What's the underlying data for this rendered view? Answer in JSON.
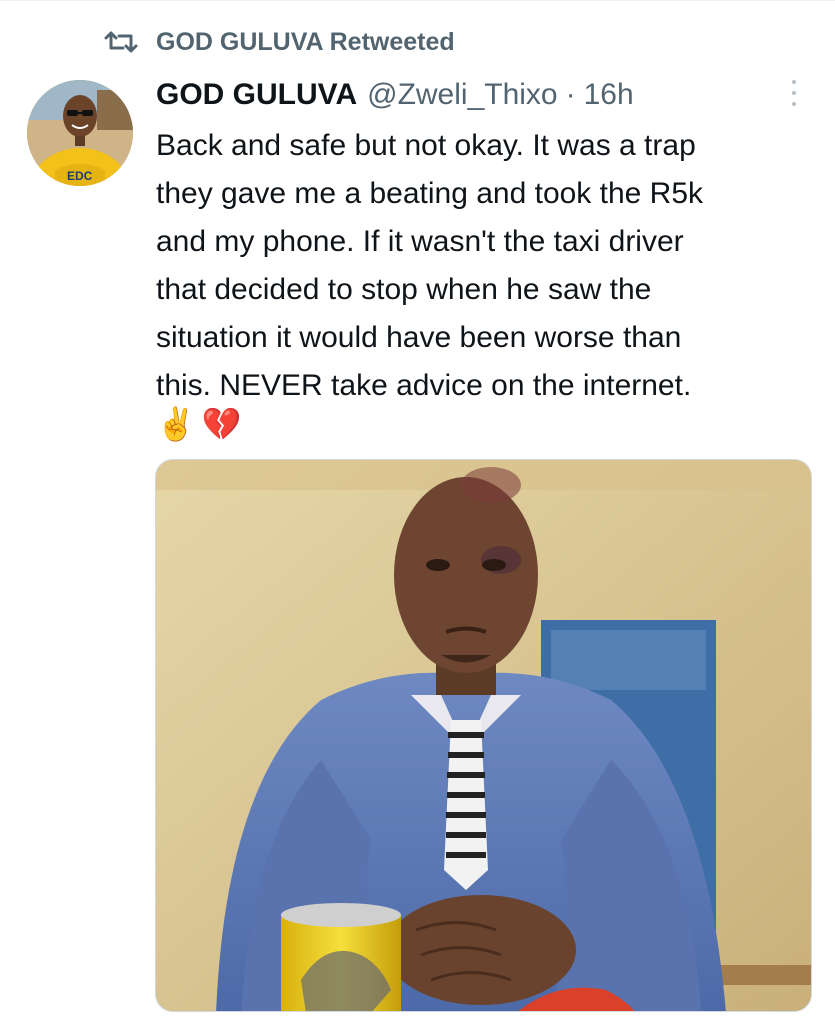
{
  "retweet_context": {
    "label": "GOD GULUVA Retweeted",
    "icon": "retweet-icon"
  },
  "tweet": {
    "display_name": "GOD GULUVA",
    "handle": "@Zweli_Thixo",
    "separator": "·",
    "time": "16h",
    "text_lines": [
      "Back and safe but not okay. It was a trap",
      "they gave me a beating and took the R5k",
      "and my phone. If it wasn't the taxi driver",
      "that decided to stop when he saw the",
      "situation it would have been worse than",
      "this. NEVER take advice on the internet."
    ],
    "emojis": [
      "✌️",
      "💔"
    ],
    "more_icon": "more-vertical-icon",
    "avatar_logo_text": "EDC"
  },
  "colors": {
    "text": "#0f1419",
    "secondary": "#536471",
    "border": "#cfd9de"
  }
}
